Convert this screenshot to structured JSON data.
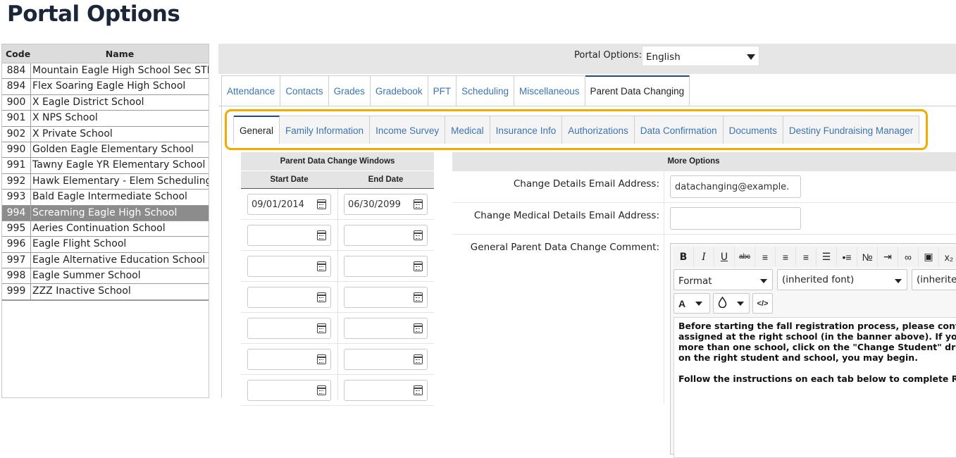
{
  "page": {
    "title": "Portal Options"
  },
  "school_list": {
    "headers": {
      "code": "Code",
      "name": "Name"
    },
    "rows": [
      {
        "code": "884",
        "name": "Mountain Eagle High School Sec STF"
      },
      {
        "code": "894",
        "name": "Flex Soaring Eagle High School"
      },
      {
        "code": "900",
        "name": "X Eagle District School"
      },
      {
        "code": "901",
        "name": "X NPS School"
      },
      {
        "code": "902",
        "name": "X Private School"
      },
      {
        "code": "990",
        "name": "Golden Eagle Elementary School"
      },
      {
        "code": "991",
        "name": "Tawny Eagle YR Elementary School"
      },
      {
        "code": "992",
        "name": "Hawk Elementary - Elem Scheduling"
      },
      {
        "code": "993",
        "name": "Bald Eagle Intermediate School"
      },
      {
        "code": "994",
        "name": "Screaming Eagle High School",
        "selected": true
      },
      {
        "code": "995",
        "name": "Aeries Continuation School"
      },
      {
        "code": "996",
        "name": "Eagle Flight School"
      },
      {
        "code": "997",
        "name": "Eagle Alternative Education School"
      },
      {
        "code": "998",
        "name": "Eagle Summer School"
      },
      {
        "code": "999",
        "name": "ZZZ Inactive School"
      }
    ]
  },
  "options_bar": {
    "label": "Portal Options:",
    "language": "English"
  },
  "main_tabs": [
    {
      "label": "Attendance"
    },
    {
      "label": "Contacts"
    },
    {
      "label": "Grades"
    },
    {
      "label": "Gradebook"
    },
    {
      "label": "PFT"
    },
    {
      "label": "Scheduling"
    },
    {
      "label": "Miscellaneous"
    },
    {
      "label": "Parent Data Changing",
      "active": true
    }
  ],
  "sub_tabs": [
    {
      "label": "General",
      "active": true
    },
    {
      "label": "Family Information"
    },
    {
      "label": "Income Survey"
    },
    {
      "label": "Medical"
    },
    {
      "label": "Insurance Info"
    },
    {
      "label": "Authorizations"
    },
    {
      "label": "Data Confirmation"
    },
    {
      "label": "Documents"
    },
    {
      "label": "Destiny Fundraising Manager"
    }
  ],
  "windows": {
    "title": "Parent Data Change Windows",
    "start_header": "Start Date",
    "end_header": "End Date",
    "rows": [
      {
        "start": "09/01/2014",
        "end": "06/30/2099"
      },
      {
        "start": "",
        "end": ""
      },
      {
        "start": "",
        "end": ""
      },
      {
        "start": "",
        "end": ""
      },
      {
        "start": "",
        "end": ""
      },
      {
        "start": "",
        "end": ""
      },
      {
        "start": "",
        "end": ""
      }
    ]
  },
  "more_options": {
    "title": "More Options",
    "change_email_label": "Change Details Email Address:",
    "change_email_value": "datachanging@example.",
    "medical_email_label": "Change Medical Details Email Address:",
    "medical_email_value": "",
    "comment_label": "General Parent Data Change Comment:"
  },
  "editor": {
    "format_label": "Format",
    "font_label": "(inherited font)",
    "size_label": "(inherite",
    "text_color_label": "A",
    "toolbar_icons": [
      "bold-icon",
      "italic-icon",
      "underline-icon",
      "strikethrough-icon",
      "align-left-icon",
      "align-center-icon",
      "align-right-icon",
      "align-justify-icon",
      "bullet-list-icon",
      "numbered-list-icon",
      "indent-icon",
      "link-icon",
      "image-icon",
      "subscript-icon"
    ],
    "paragraph1": [
      "Before starting the fall registration process, please confirm",
      "assigned at the right school (in the banner above). If your",
      "more than one school, click on the \"Change Student\" dropd",
      "on the right student and school, you may begin."
    ],
    "paragraph2": "Follow the instructions on each tab below to complete Reg"
  },
  "colors": {
    "highlight": "#f2a900",
    "link": "#3a74b6",
    "active_tab_border": "#224a80",
    "selected_row": "#8c8c8c"
  }
}
